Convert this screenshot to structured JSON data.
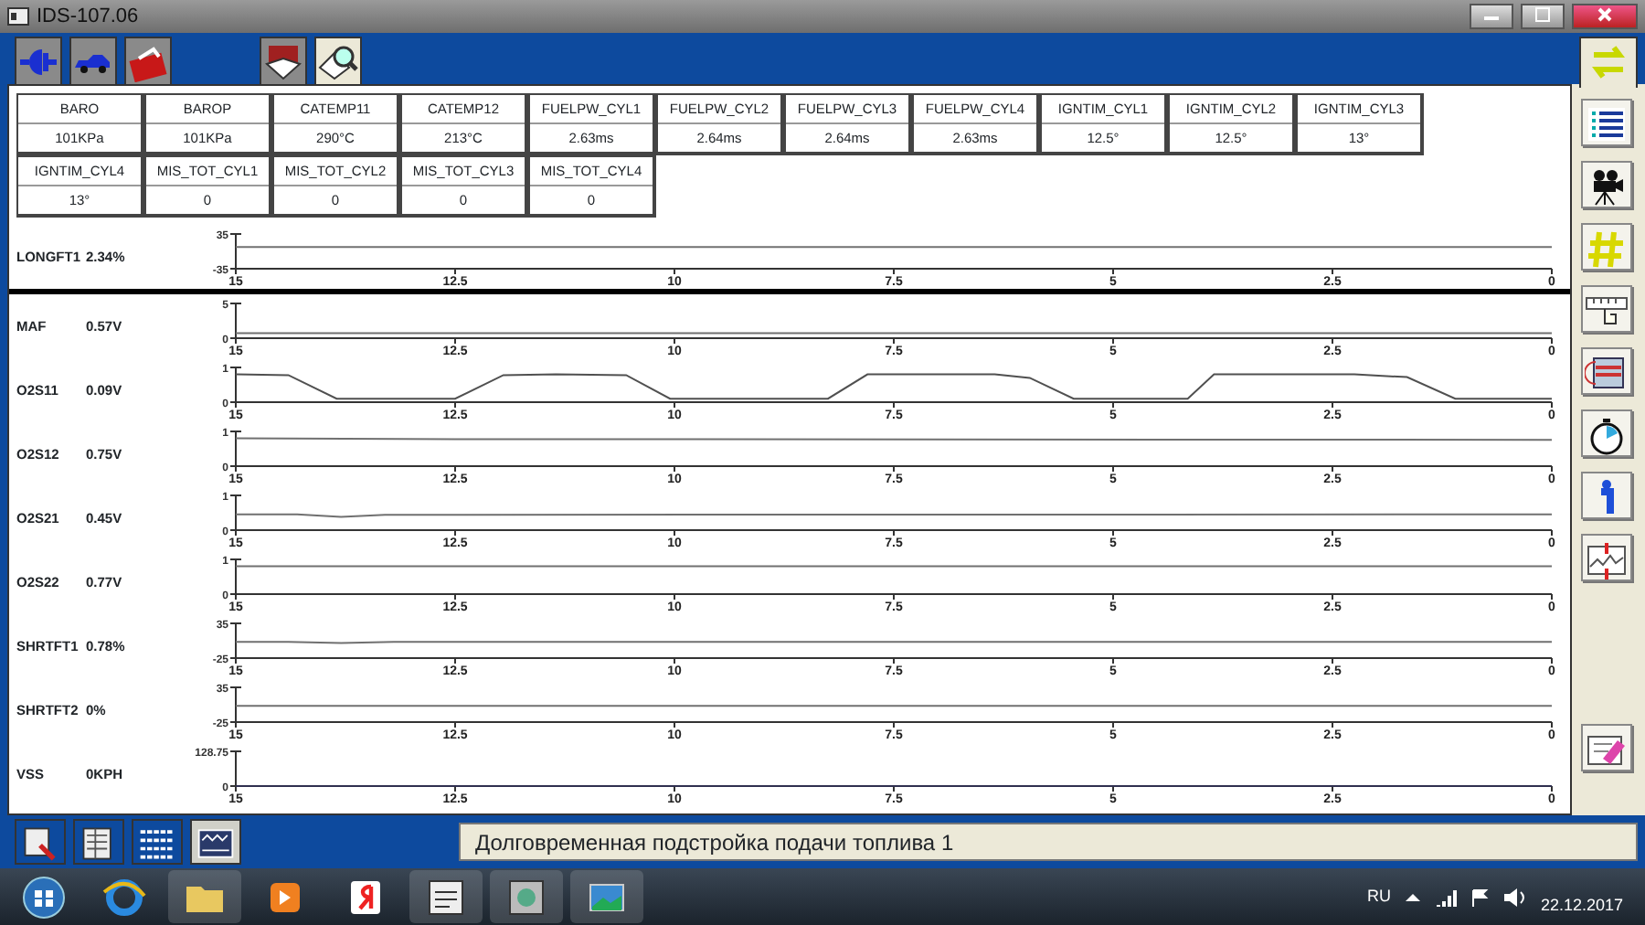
{
  "window": {
    "title": "IDS-107.06"
  },
  "tab_groups": [
    [
      {
        "selected": false
      },
      {
        "selected": false
      },
      {
        "selected": false
      }
    ],
    [
      {
        "selected": false
      },
      {
        "selected": true
      }
    ]
  ],
  "pids": [
    {
      "name": "BARO",
      "value": "101KPa"
    },
    {
      "name": "BAROP",
      "value": "101KPa"
    },
    {
      "name": "CATEMP11",
      "value": "290°C"
    },
    {
      "name": "CATEMP12",
      "value": "213°C"
    },
    {
      "name": "FUELPW_CYL1",
      "value": "2.63ms"
    },
    {
      "name": "FUELPW_CYL2",
      "value": "2.64ms"
    },
    {
      "name": "FUELPW_CYL3",
      "value": "2.64ms"
    },
    {
      "name": "FUELPW_CYL4",
      "value": "2.63ms"
    },
    {
      "name": "IGNTIM_CYL1",
      "value": "12.5°"
    },
    {
      "name": "IGNTIM_CYL2",
      "value": "12.5°"
    },
    {
      "name": "IGNTIM_CYL3",
      "value": "13°"
    },
    {
      "name": "IGNTIM_CYL4",
      "value": "13°"
    },
    {
      "name": "MIS_TOT_CYL1",
      "value": "0"
    },
    {
      "name": "MIS_TOT_CYL2",
      "value": "0"
    },
    {
      "name": "MIS_TOT_CYL3",
      "value": "0"
    },
    {
      "name": "MIS_TOT_CYL4",
      "value": "0"
    }
  ],
  "graphs": [
    {
      "label": "LONGFT1",
      "reading": "2.34%",
      "chart_data": {
        "type": "line",
        "x": [
          15,
          0
        ],
        "series": [
          {
            "color": "#707070",
            "values": [
              9,
              9
            ]
          }
        ],
        "xlim": [
          15,
          0
        ],
        "ylim": [
          -35,
          35
        ],
        "xticks": [
          15,
          12.5,
          10,
          7.5,
          5,
          2.5,
          0
        ],
        "yticks": [
          -35,
          35
        ]
      }
    },
    {
      "label": "MAF",
      "reading": "0.57V",
      "chart_data": {
        "type": "line",
        "x": [
          15,
          0
        ],
        "series": [
          {
            "color": "#707070",
            "values": [
              0.7,
              0.7
            ]
          }
        ],
        "xlim": [
          15,
          0
        ],
        "ylim": [
          0,
          5
        ],
        "xticks": [
          15,
          12.5,
          10,
          7.5,
          5,
          2.5,
          0
        ],
        "yticks": [
          0,
          5
        ]
      }
    },
    {
      "label": "O2S11",
      "reading": "0.09V",
      "chart_data": {
        "type": "line",
        "x": [
          15,
          14.4,
          13.85,
          12.5,
          11.95,
          11.35,
          10.55,
          10.05,
          8.25,
          7.8,
          6.35,
          5.95,
          5.45,
          4.15,
          3.85,
          2.25,
          1.65,
          1.1,
          0
        ],
        "series": [
          {
            "color": "#505050",
            "values": [
              0.8,
              0.78,
              0.1,
              0.1,
              0.78,
              0.8,
              0.78,
              0.1,
              0.1,
              0.8,
              0.8,
              0.7,
              0.1,
              0.1,
              0.8,
              0.8,
              0.72,
              0.1,
              0.1
            ]
          }
        ],
        "xlim": [
          15,
          0
        ],
        "ylim": [
          0,
          1
        ],
        "xticks": [
          15,
          12.5,
          10,
          7.5,
          5,
          2.5,
          0
        ],
        "yticks": [
          0,
          1
        ]
      }
    },
    {
      "label": "O2S12",
      "reading": "0.75V",
      "chart_data": {
        "type": "line",
        "x": [
          15,
          12.5,
          0
        ],
        "series": [
          {
            "color": "#707070",
            "values": [
              0.8,
              0.78,
              0.76
            ]
          }
        ],
        "xlim": [
          15,
          0
        ],
        "ylim": [
          0,
          1
        ],
        "xticks": [
          15,
          12.5,
          10,
          7.5,
          5,
          2.5,
          0
        ],
        "yticks": [
          0,
          1
        ]
      }
    },
    {
      "label": "O2S21",
      "reading": "0.45V",
      "chart_data": {
        "type": "line",
        "x": [
          15,
          14.3,
          13.8,
          13.3,
          0
        ],
        "series": [
          {
            "color": "#707070",
            "values": [
              0.45,
              0.45,
              0.38,
              0.44,
              0.45
            ]
          }
        ],
        "xlim": [
          15,
          0
        ],
        "ylim": [
          0,
          1
        ],
        "xticks": [
          15,
          12.5,
          10,
          7.5,
          5,
          2.5,
          0
        ],
        "yticks": [
          0,
          1
        ]
      }
    },
    {
      "label": "O2S22",
      "reading": "0.77V",
      "chart_data": {
        "type": "line",
        "x": [
          15,
          0
        ],
        "series": [
          {
            "color": "#707070",
            "values": [
              0.8,
              0.8
            ]
          }
        ],
        "xlim": [
          15,
          0
        ],
        "ylim": [
          0,
          1
        ],
        "xticks": [
          15,
          12.5,
          10,
          7.5,
          5,
          2.5,
          0
        ],
        "yticks": [
          0,
          1
        ]
      }
    },
    {
      "label": "SHRTFT1",
      "reading": "0.78%",
      "chart_data": {
        "type": "line",
        "x": [
          15,
          14.4,
          13.8,
          13.2,
          0
        ],
        "series": [
          {
            "color": "#707070",
            "values": [
              3,
              3,
              1,
              3,
              3
            ]
          }
        ],
        "xlim": [
          15,
          0
        ],
        "ylim": [
          -25,
          35
        ],
        "xticks": [
          15,
          12.5,
          10,
          7.5,
          5,
          2.5,
          0
        ],
        "yticks": [
          -25,
          35
        ]
      }
    },
    {
      "label": "SHRTFT2",
      "reading": "0%",
      "chart_data": {
        "type": "line",
        "x": [
          15,
          0
        ],
        "series": [
          {
            "color": "#707070",
            "values": [
              3,
              3
            ]
          }
        ],
        "xlim": [
          15,
          0
        ],
        "ylim": [
          -25,
          35
        ],
        "xticks": [
          15,
          12.5,
          10,
          7.5,
          5,
          2.5,
          0
        ],
        "yticks": [
          -25,
          35
        ]
      }
    },
    {
      "label": "VSS",
      "reading": "0KPH",
      "chart_data": {
        "type": "line",
        "x": [
          15,
          0
        ],
        "series": [
          {
            "color": "#303050",
            "values": [
              0,
              0
            ]
          }
        ],
        "xlim": [
          15,
          0
        ],
        "ylim": [
          0,
          128.75
        ],
        "xticks": [
          15,
          12.5,
          10,
          7.5,
          5,
          2.5,
          0
        ],
        "yticks": [
          0,
          128.75
        ]
      }
    }
  ],
  "view_buttons": [
    {
      "selected": false
    },
    {
      "selected": false
    },
    {
      "selected": false
    },
    {
      "selected": true
    }
  ],
  "status_text": "Долговременная подстройка подачи топлива 1",
  "taskbar": {
    "language": "RU",
    "date": "22.12.2017"
  }
}
